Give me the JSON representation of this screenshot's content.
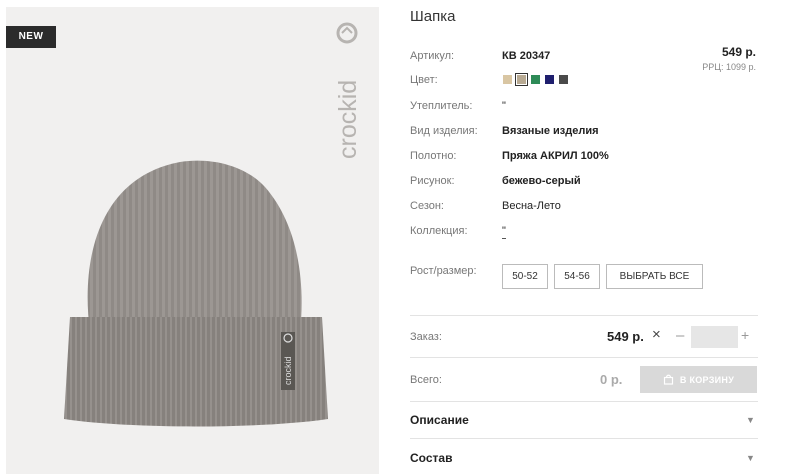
{
  "product": {
    "title": "Шапка",
    "badge": "NEW",
    "brand": "crockid",
    "price": "549 р.",
    "rrc_price": "РРЦ: 1099 р."
  },
  "attributes": [
    {
      "label": "Артикул:",
      "value": "КВ 20347"
    },
    {
      "label": "Цвет:",
      "value": ""
    },
    {
      "label": "Утеплитель:",
      "value": "\""
    },
    {
      "label": "Вид изделия:",
      "value": "Вязаные изделия"
    },
    {
      "label": "Полотно:",
      "value": "Пряжа АКРИЛ 100%"
    },
    {
      "label": "Рисунок:",
      "value": "бежево-серый"
    },
    {
      "label": "Сезон:",
      "value": "Весна-Лето"
    },
    {
      "label": "Коллекция:",
      "value": "\""
    }
  ],
  "colors": [
    {
      "hex": "#d9c6a3",
      "name": "beige"
    },
    {
      "hex": "#b8aa93",
      "name": "beige-grey",
      "selected": true
    },
    {
      "hex": "#2e8b57",
      "name": "green"
    },
    {
      "hex": "#1f1f6e",
      "name": "navy"
    },
    {
      "hex": "#4a4a4a",
      "name": "dark-grey"
    }
  ],
  "sizes": {
    "label": "Рост/размер:",
    "options": [
      "50-52",
      "54-56"
    ],
    "select_all": "ВЫБРАТЬ ВСЕ"
  },
  "order": {
    "label": "Заказ:",
    "price": "549 р.",
    "remove_icon": "×",
    "minus_icon": "–",
    "plus_icon": "+",
    "quantity": ""
  },
  "total": {
    "label": "Всего:",
    "value": "0 р.",
    "cart_button": "В КОРЗИНУ"
  },
  "accordion": [
    {
      "title": "Описание",
      "caret": "▼"
    },
    {
      "title": "Состав",
      "caret": "▼"
    }
  ]
}
